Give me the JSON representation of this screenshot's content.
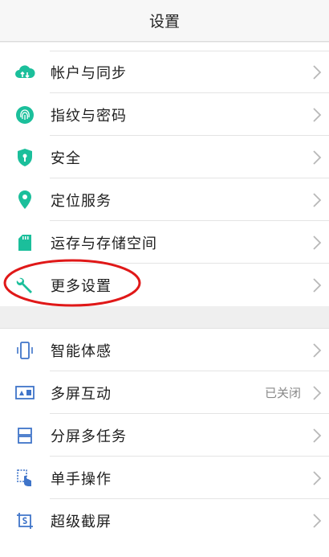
{
  "header": {
    "title": "设置"
  },
  "group1": {
    "items": [
      {
        "label": "帐户与同步",
        "icon": "cloud-sync-icon"
      },
      {
        "label": "指纹与密码",
        "icon": "fingerprint-icon"
      },
      {
        "label": "安全",
        "icon": "shield-icon"
      },
      {
        "label": "定位服务",
        "icon": "location-pin-icon"
      },
      {
        "label": "运存与存储空间",
        "icon": "sd-card-icon"
      },
      {
        "label": "更多设置",
        "icon": "wrench-icon"
      }
    ]
  },
  "group2": {
    "items": [
      {
        "label": "智能体感",
        "icon": "phone-motion-icon"
      },
      {
        "label": "多屏互动",
        "icon": "screen-cast-icon",
        "value": "已关闭"
      },
      {
        "label": "分屏多任务",
        "icon": "split-screen-icon"
      },
      {
        "label": "单手操作",
        "icon": "one-hand-icon"
      },
      {
        "label": "超级截屏",
        "icon": "screenshot-icon"
      }
    ]
  },
  "colors": {
    "teal_icon": "#1bbf9b",
    "blue_icon": "#3f74c9",
    "annotation": "#e01818",
    "chevron": "#b8b8b8"
  }
}
